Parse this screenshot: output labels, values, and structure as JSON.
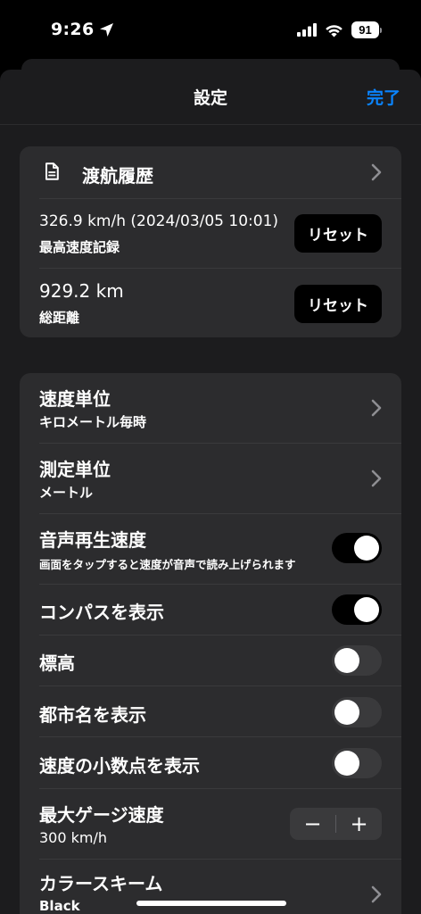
{
  "status": {
    "time": "9:26",
    "battery": "91"
  },
  "nav": {
    "title": "設定",
    "done": "完了"
  },
  "history": {
    "label": "渡航履歴",
    "max_speed_value": "326.9 km/h (2024/03/05 10:01)",
    "max_speed_label": "最高速度記録",
    "total_distance_value": "929.2 km",
    "total_distance_label": "総距離",
    "reset_label": "リセット"
  },
  "settings": {
    "speed_unit": {
      "title": "速度単位",
      "value": "キロメートル毎時"
    },
    "measure_unit": {
      "title": "測定単位",
      "value": "メートル"
    },
    "voice_speed": {
      "title": "音声再生速度",
      "description": "画面をタップすると速度が音声で読み上げられます",
      "on": true
    },
    "show_compass": {
      "title": "コンパスを表示",
      "on": true
    },
    "altitude": {
      "title": "標高",
      "on": false
    },
    "show_city": {
      "title": "都市名を表示",
      "on": false
    },
    "show_decimal": {
      "title": "速度の小数点を表示",
      "on": false
    },
    "max_gauge": {
      "title": "最大ゲージ速度",
      "value": "300 km/h",
      "minus": "−",
      "plus": "+"
    },
    "color_scheme": {
      "title": "カラースキーム",
      "value": "Black"
    }
  },
  "colors": {
    "accent": "#0a84ff",
    "sheet": "#1c1c1e",
    "cell": "#2c2c2e"
  }
}
